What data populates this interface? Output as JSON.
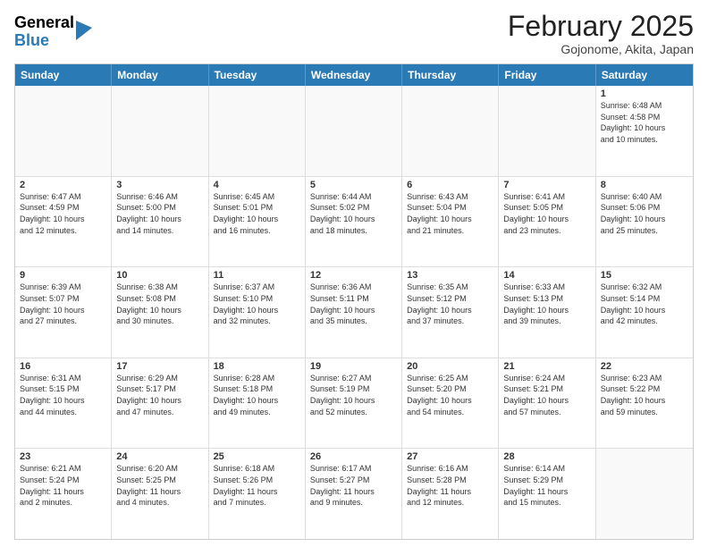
{
  "header": {
    "logo_general": "General",
    "logo_blue": "Blue",
    "month_title": "February 2025",
    "location": "Gojonome, Akita, Japan"
  },
  "days_of_week": [
    "Sunday",
    "Monday",
    "Tuesday",
    "Wednesday",
    "Thursday",
    "Friday",
    "Saturday"
  ],
  "weeks": [
    [
      {
        "day": "",
        "info": ""
      },
      {
        "day": "",
        "info": ""
      },
      {
        "day": "",
        "info": ""
      },
      {
        "day": "",
        "info": ""
      },
      {
        "day": "",
        "info": ""
      },
      {
        "day": "",
        "info": ""
      },
      {
        "day": "1",
        "info": "Sunrise: 6:48 AM\nSunset: 4:58 PM\nDaylight: 10 hours\nand 10 minutes."
      }
    ],
    [
      {
        "day": "2",
        "info": "Sunrise: 6:47 AM\nSunset: 4:59 PM\nDaylight: 10 hours\nand 12 minutes."
      },
      {
        "day": "3",
        "info": "Sunrise: 6:46 AM\nSunset: 5:00 PM\nDaylight: 10 hours\nand 14 minutes."
      },
      {
        "day": "4",
        "info": "Sunrise: 6:45 AM\nSunset: 5:01 PM\nDaylight: 10 hours\nand 16 minutes."
      },
      {
        "day": "5",
        "info": "Sunrise: 6:44 AM\nSunset: 5:02 PM\nDaylight: 10 hours\nand 18 minutes."
      },
      {
        "day": "6",
        "info": "Sunrise: 6:43 AM\nSunset: 5:04 PM\nDaylight: 10 hours\nand 21 minutes."
      },
      {
        "day": "7",
        "info": "Sunrise: 6:41 AM\nSunset: 5:05 PM\nDaylight: 10 hours\nand 23 minutes."
      },
      {
        "day": "8",
        "info": "Sunrise: 6:40 AM\nSunset: 5:06 PM\nDaylight: 10 hours\nand 25 minutes."
      }
    ],
    [
      {
        "day": "9",
        "info": "Sunrise: 6:39 AM\nSunset: 5:07 PM\nDaylight: 10 hours\nand 27 minutes."
      },
      {
        "day": "10",
        "info": "Sunrise: 6:38 AM\nSunset: 5:08 PM\nDaylight: 10 hours\nand 30 minutes."
      },
      {
        "day": "11",
        "info": "Sunrise: 6:37 AM\nSunset: 5:10 PM\nDaylight: 10 hours\nand 32 minutes."
      },
      {
        "day": "12",
        "info": "Sunrise: 6:36 AM\nSunset: 5:11 PM\nDaylight: 10 hours\nand 35 minutes."
      },
      {
        "day": "13",
        "info": "Sunrise: 6:35 AM\nSunset: 5:12 PM\nDaylight: 10 hours\nand 37 minutes."
      },
      {
        "day": "14",
        "info": "Sunrise: 6:33 AM\nSunset: 5:13 PM\nDaylight: 10 hours\nand 39 minutes."
      },
      {
        "day": "15",
        "info": "Sunrise: 6:32 AM\nSunset: 5:14 PM\nDaylight: 10 hours\nand 42 minutes."
      }
    ],
    [
      {
        "day": "16",
        "info": "Sunrise: 6:31 AM\nSunset: 5:15 PM\nDaylight: 10 hours\nand 44 minutes."
      },
      {
        "day": "17",
        "info": "Sunrise: 6:29 AM\nSunset: 5:17 PM\nDaylight: 10 hours\nand 47 minutes."
      },
      {
        "day": "18",
        "info": "Sunrise: 6:28 AM\nSunset: 5:18 PM\nDaylight: 10 hours\nand 49 minutes."
      },
      {
        "day": "19",
        "info": "Sunrise: 6:27 AM\nSunset: 5:19 PM\nDaylight: 10 hours\nand 52 minutes."
      },
      {
        "day": "20",
        "info": "Sunrise: 6:25 AM\nSunset: 5:20 PM\nDaylight: 10 hours\nand 54 minutes."
      },
      {
        "day": "21",
        "info": "Sunrise: 6:24 AM\nSunset: 5:21 PM\nDaylight: 10 hours\nand 57 minutes."
      },
      {
        "day": "22",
        "info": "Sunrise: 6:23 AM\nSunset: 5:22 PM\nDaylight: 10 hours\nand 59 minutes."
      }
    ],
    [
      {
        "day": "23",
        "info": "Sunrise: 6:21 AM\nSunset: 5:24 PM\nDaylight: 11 hours\nand 2 minutes."
      },
      {
        "day": "24",
        "info": "Sunrise: 6:20 AM\nSunset: 5:25 PM\nDaylight: 11 hours\nand 4 minutes."
      },
      {
        "day": "25",
        "info": "Sunrise: 6:18 AM\nSunset: 5:26 PM\nDaylight: 11 hours\nand 7 minutes."
      },
      {
        "day": "26",
        "info": "Sunrise: 6:17 AM\nSunset: 5:27 PM\nDaylight: 11 hours\nand 9 minutes."
      },
      {
        "day": "27",
        "info": "Sunrise: 6:16 AM\nSunset: 5:28 PM\nDaylight: 11 hours\nand 12 minutes."
      },
      {
        "day": "28",
        "info": "Sunrise: 6:14 AM\nSunset: 5:29 PM\nDaylight: 11 hours\nand 15 minutes."
      },
      {
        "day": "",
        "info": ""
      }
    ]
  ]
}
